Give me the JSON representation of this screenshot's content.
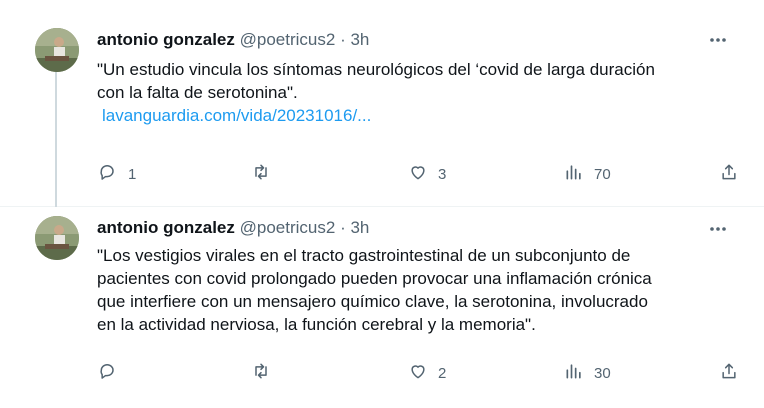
{
  "tweets": [
    {
      "author_name": "antonio gonzalez",
      "handle": "@poetricus2",
      "separator": "·",
      "time": "3h",
      "text_line1": "\"Un estudio vincula los síntomas neurológicos del ‘covid de larga duración",
      "text_line2": "con la falta de serotonina\".",
      "link": "lavanguardia.com/vida/20231016/...",
      "replies": "1",
      "reposts": "",
      "likes": "3",
      "views": "70"
    },
    {
      "author_name": "antonio gonzalez",
      "handle": "@poetricus2",
      "separator": "·",
      "time": "3h",
      "text_lines": [
        "\"Los vestigios virales en el tracto gastrointestinal de un subconjunto de",
        "pacientes con covid prolongado pueden provocar una inflamación crónica",
        "que interfiere con un mensajero químico clave, la serotonina, involucrado",
        "en la actividad nerviosa, la función cerebral y la memoria\"."
      ],
      "replies": "",
      "reposts": "",
      "likes": "2",
      "views": "30"
    }
  ],
  "icons": {
    "reply": "reply-icon",
    "repost": "repost-icon",
    "like": "heart-icon",
    "views": "views-chart-icon",
    "share": "share-icon",
    "more": "more-icon"
  },
  "colors": {
    "text": "#0f1419",
    "secondary": "#536471",
    "link": "#1d9bf0",
    "divider": "#eff3f4"
  }
}
